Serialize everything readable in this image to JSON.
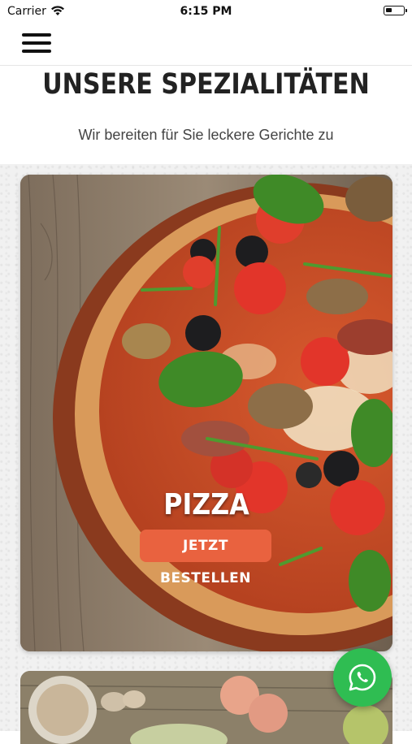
{
  "status_bar": {
    "carrier": "Carrier",
    "time": "6:15 PM",
    "battery_level": 0.35
  },
  "header": {
    "menu_icon": "hamburger-menu-icon"
  },
  "section": {
    "title": "UNSERE SPEZIALITÄTEN",
    "subtitle": "Wir bereiten für Sie leckere Gerichte zu"
  },
  "cards": [
    {
      "label": "PIZZA",
      "button_label": "JETZT BESTELLEN"
    }
  ],
  "floating": {
    "icon": "whatsapp-icon",
    "color": "#2fbd52"
  },
  "colors": {
    "accent": "#e9623f",
    "heading": "#222222"
  }
}
